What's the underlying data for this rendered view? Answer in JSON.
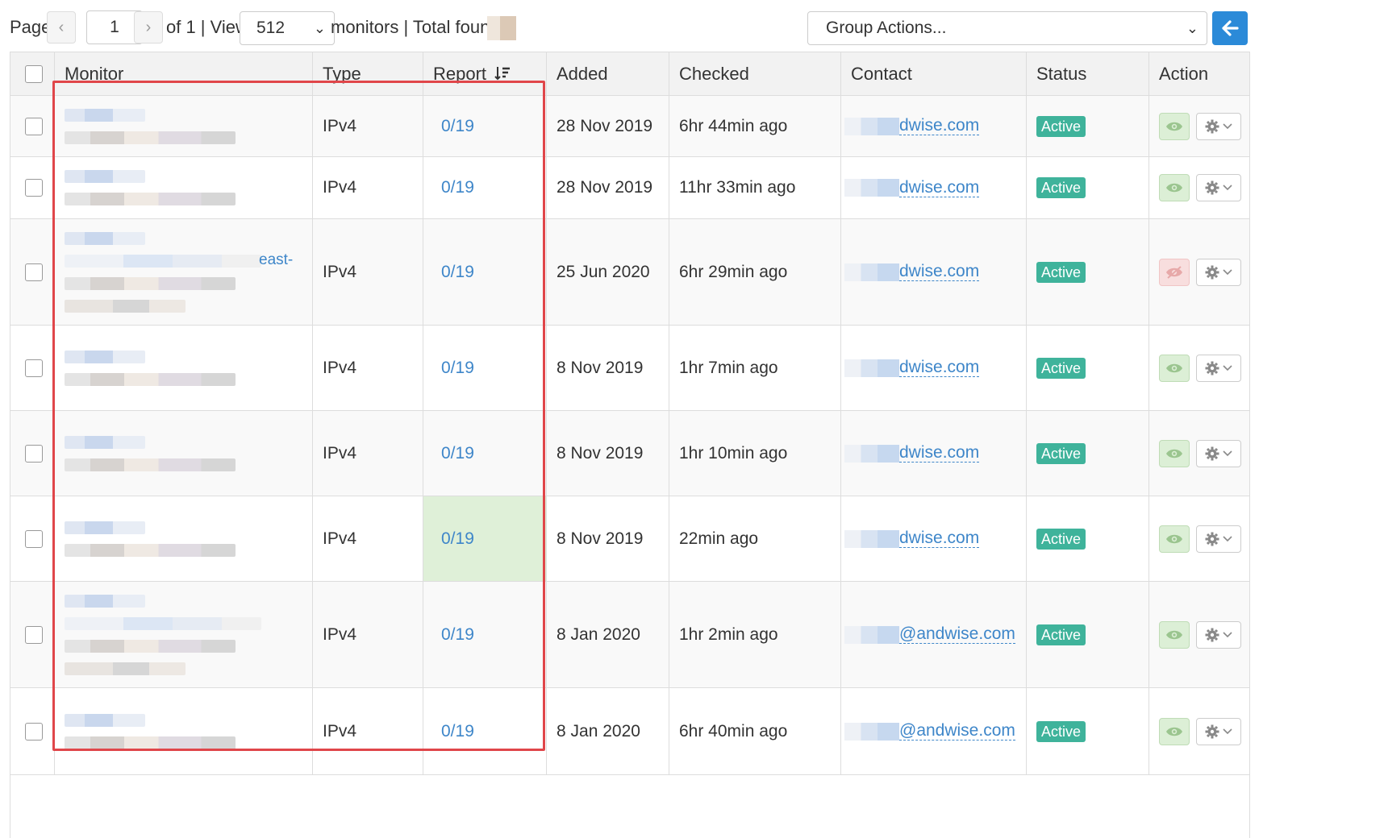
{
  "toolbar": {
    "page_label": "Page",
    "prev_symbol": "‹",
    "page_value": "1",
    "next_symbol": "›",
    "of_text": "of 1 | View",
    "view_value": "512",
    "monitors_text": "monitors | Total found:",
    "group_actions": "Group Actions..."
  },
  "columns": {
    "monitor": "Monitor",
    "type": "Type",
    "report": "Report",
    "added": "Added",
    "checked": "Checked",
    "contact": "Contact",
    "status": "Status",
    "action": "Action"
  },
  "rows": [
    {
      "type": "IPv4",
      "report": "0/19",
      "added": "28 Nov 2019",
      "checked": "6hr 44min ago",
      "contact": "dwise.com",
      "status": "Active"
    },
    {
      "type": "IPv4",
      "report": "0/19",
      "added": "28 Nov 2019",
      "checked": "11hr 33min ago",
      "contact": "dwise.com",
      "status": "Active"
    },
    {
      "type": "IPv4",
      "report": "0/19",
      "added": "25 Jun 2020",
      "checked": "6hr 29min ago",
      "contact": "dwise.com",
      "status": "Active",
      "monitor_tail": "east-"
    },
    {
      "type": "IPv4",
      "report": "0/19",
      "added": "8 Nov 2019",
      "checked": "1hr 7min ago",
      "contact": "dwise.com",
      "status": "Active"
    },
    {
      "type": "IPv4",
      "report": "0/19",
      "added": "8 Nov 2019",
      "checked": "1hr 10min ago",
      "contact": "dwise.com",
      "status": "Active"
    },
    {
      "type": "IPv4",
      "report": "0/19",
      "added": "8 Nov 2019",
      "checked": "22min ago",
      "contact": "dwise.com",
      "status": "Active"
    },
    {
      "type": "IPv4",
      "report": "0/19",
      "added": "8 Jan 2020",
      "checked": "1hr 2min ago",
      "contact": "@andwise.com",
      "status": "Active"
    },
    {
      "type": "IPv4",
      "report": "0/19",
      "added": "8 Jan 2020",
      "checked": "6hr 40min ago",
      "contact": "@andwise.com",
      "status": "Active"
    }
  ],
  "colors": {
    "accent": "#2b8ad8",
    "link": "#3e86c9",
    "status_active": "#3fb39b",
    "highlight_box": "#e0464a",
    "report_highlight_bg": "#dff0d8"
  },
  "icons": [
    "chevron-left-icon",
    "chevron-right-icon",
    "chevron-down-icon",
    "arrow-left-icon",
    "sort-icon",
    "eye-icon",
    "eye-slash-icon",
    "gear-icon"
  ]
}
